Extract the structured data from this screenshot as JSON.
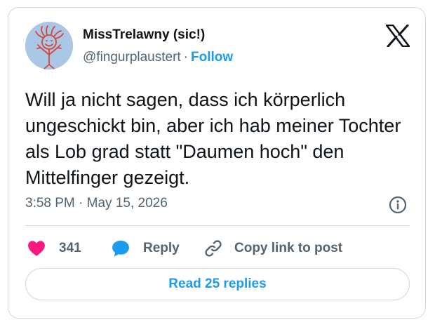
{
  "tweet": {
    "author_name": "MissTrelawny (sic!)",
    "author_handle": "@fingurplaustert",
    "separator": "·",
    "follow_label": "Follow",
    "text": "Will ja nicht sagen, dass ich körperlich ungeschickt bin, aber ich hab meiner Tochter als Lob grad statt \"Daumen hoch\" den Mittelfinger gezeigt.",
    "timestamp": "3:58 PM · May 15, 2026"
  },
  "actions": {
    "likes_count": "341",
    "reply_label": "Reply",
    "copy_label": "Copy link to post",
    "read_replies_label": "Read 25 replies"
  },
  "icons": {
    "like": "heart-icon",
    "reply": "speech-bubble-icon",
    "copy": "link-icon",
    "info": "info-icon",
    "platform": "x-logo-icon"
  },
  "colors": {
    "accent": "#1d9bf0",
    "like": "#f91880",
    "muted": "#536471",
    "text": "#0f1419",
    "border": "#cfd9de"
  }
}
